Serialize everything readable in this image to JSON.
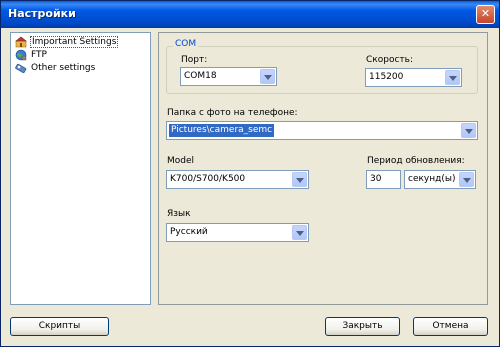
{
  "window": {
    "title": "Настройки",
    "close_glyph": "✕"
  },
  "tree": {
    "items": [
      {
        "label": "Important Settings",
        "icon": "folder-house-icon",
        "selected": true
      },
      {
        "label": "FTP",
        "icon": "globe-icon",
        "selected": false
      },
      {
        "label": "Other settings",
        "icon": "tools-icon",
        "selected": false
      }
    ]
  },
  "com": {
    "legend": "COM",
    "port_label": "Порт:",
    "port_value": "COM18",
    "speed_label": "Скорость:",
    "speed_value": "115200"
  },
  "photo_folder": {
    "label": "Папка с фото на телефоне:",
    "value": "Pictures\\camera_semc"
  },
  "model": {
    "label": "Model",
    "value": "K700/S700/K500"
  },
  "refresh": {
    "label": "Период обновления:",
    "value": "30",
    "unit": "секунд(ы)"
  },
  "language": {
    "label": "Язык",
    "value": "Русский"
  },
  "buttons": {
    "scripts": "Скрипты",
    "close": "Закрыть",
    "cancel": "Отмена"
  },
  "colors": {
    "titlebar": "#0054e3",
    "dialog_bg": "#ece9d8",
    "group_legend": "#0046d5",
    "selection": "#316ac5"
  }
}
